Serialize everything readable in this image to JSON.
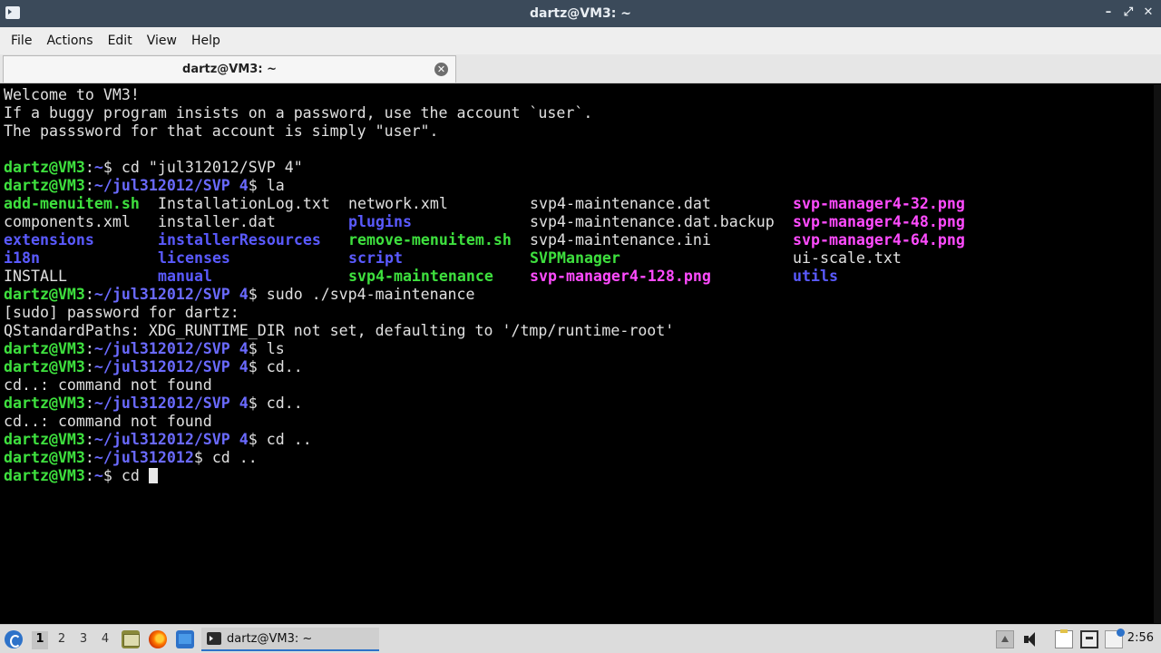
{
  "window": {
    "title": "dartz@VM3: ~",
    "controls": {
      "minimize": "–",
      "restore": "⤢",
      "close": "✕"
    }
  },
  "menubar": {
    "items": [
      "File",
      "Actions",
      "Edit",
      "View",
      "Help"
    ]
  },
  "tabs": [
    {
      "label": "dartz@VM3: ~",
      "close": "✕"
    }
  ],
  "terminal": {
    "lines": [
      {
        "type": "text",
        "text": "Welcome to VM3!"
      },
      {
        "type": "text",
        "text": "If a buggy program insists on a password, use the account `user`."
      },
      {
        "type": "text",
        "text": "The passsword for that account is simply \"user\"."
      },
      {
        "type": "text",
        "text": ""
      },
      {
        "type": "prompt",
        "user": "dartz@VM3",
        "path": "~",
        "cmd": " cd \"jul312012/SVP 4\""
      },
      {
        "type": "prompt",
        "user": "dartz@VM3",
        "path": "~/jul312012/SVP 4",
        "cmd": " la"
      },
      {
        "type": "ls",
        "cells": [
          {
            "col": 0,
            "text": "add-menuitem.sh",
            "color": "green"
          },
          {
            "col": 1,
            "text": "InstallationLog.txt",
            "color": "plain"
          },
          {
            "col": 2,
            "text": "network.xml",
            "color": "plain"
          },
          {
            "col": 3,
            "text": "svp4-maintenance.dat",
            "color": "plain"
          },
          {
            "col": 4,
            "text": "svp-manager4-32.png",
            "color": "magenta"
          }
        ]
      },
      {
        "type": "ls",
        "cells": [
          {
            "col": 0,
            "text": "components.xml",
            "color": "plain"
          },
          {
            "col": 1,
            "text": "installer.dat",
            "color": "plain"
          },
          {
            "col": 2,
            "text": "plugins",
            "color": "blue"
          },
          {
            "col": 3,
            "text": "svp4-maintenance.dat.backup",
            "color": "plain"
          },
          {
            "col": 4,
            "text": "svp-manager4-48.png",
            "color": "magenta"
          }
        ]
      },
      {
        "type": "ls",
        "cells": [
          {
            "col": 0,
            "text": "extensions",
            "color": "blue"
          },
          {
            "col": 1,
            "text": "installerResources",
            "color": "blue"
          },
          {
            "col": 2,
            "text": "remove-menuitem.sh",
            "color": "green"
          },
          {
            "col": 3,
            "text": "svp4-maintenance.ini",
            "color": "plain"
          },
          {
            "col": 4,
            "text": "svp-manager4-64.png",
            "color": "magenta"
          }
        ]
      },
      {
        "type": "ls",
        "cells": [
          {
            "col": 0,
            "text": "i18n",
            "color": "blue"
          },
          {
            "col": 1,
            "text": "licenses",
            "color": "blue"
          },
          {
            "col": 2,
            "text": "script",
            "color": "blue"
          },
          {
            "col": 3,
            "text": "SVPManager",
            "color": "green"
          },
          {
            "col": 4,
            "text": "ui-scale.txt",
            "color": "plain"
          }
        ]
      },
      {
        "type": "ls",
        "cells": [
          {
            "col": 0,
            "text": "INSTALL",
            "color": "plain"
          },
          {
            "col": 1,
            "text": "manual",
            "color": "blue"
          },
          {
            "col": 2,
            "text": "svp4-maintenance",
            "color": "green"
          },
          {
            "col": 3,
            "text": "svp-manager4-128.png",
            "color": "magenta"
          },
          {
            "col": 4,
            "text": "utils",
            "color": "blue"
          }
        ]
      },
      {
        "type": "prompt",
        "user": "dartz@VM3",
        "path": "~/jul312012/SVP 4",
        "cmd": " sudo ./svp4-maintenance"
      },
      {
        "type": "text",
        "text": "[sudo] password for dartz:"
      },
      {
        "type": "text",
        "text": "QStandardPaths: XDG_RUNTIME_DIR not set, defaulting to '/tmp/runtime-root'"
      },
      {
        "type": "prompt",
        "user": "dartz@VM3",
        "path": "~/jul312012/SVP 4",
        "cmd": " ls"
      },
      {
        "type": "prompt",
        "user": "dartz@VM3",
        "path": "~/jul312012/SVP 4",
        "cmd": " cd.."
      },
      {
        "type": "text",
        "text": "cd..: command not found"
      },
      {
        "type": "prompt",
        "user": "dartz@VM3",
        "path": "~/jul312012/SVP 4",
        "cmd": " cd.."
      },
      {
        "type": "text",
        "text": "cd..: command not found"
      },
      {
        "type": "prompt",
        "user": "dartz@VM3",
        "path": "~/jul312012/SVP 4",
        "cmd": " cd .."
      },
      {
        "type": "prompt",
        "user": "dartz@VM3",
        "path": "~/jul312012",
        "cmd": " cd .."
      },
      {
        "type": "prompt",
        "user": "dartz@VM3",
        "path": "~",
        "cmd": " cd ",
        "cursor": true
      }
    ]
  },
  "taskbar": {
    "workspaces": [
      "1",
      "2",
      "3",
      "4"
    ],
    "active_workspace": "1",
    "task_label": "dartz@VM3: ~",
    "clock": "2:56"
  },
  "colors": {
    "titlebar": "#3b4a5a",
    "prompt_user": "#3ee03e",
    "prompt_path": "#6a6aff",
    "ls_green": "#3ee03e",
    "ls_blue": "#5a5aff",
    "ls_magenta": "#ff4bff",
    "accent": "#2d72c9"
  }
}
